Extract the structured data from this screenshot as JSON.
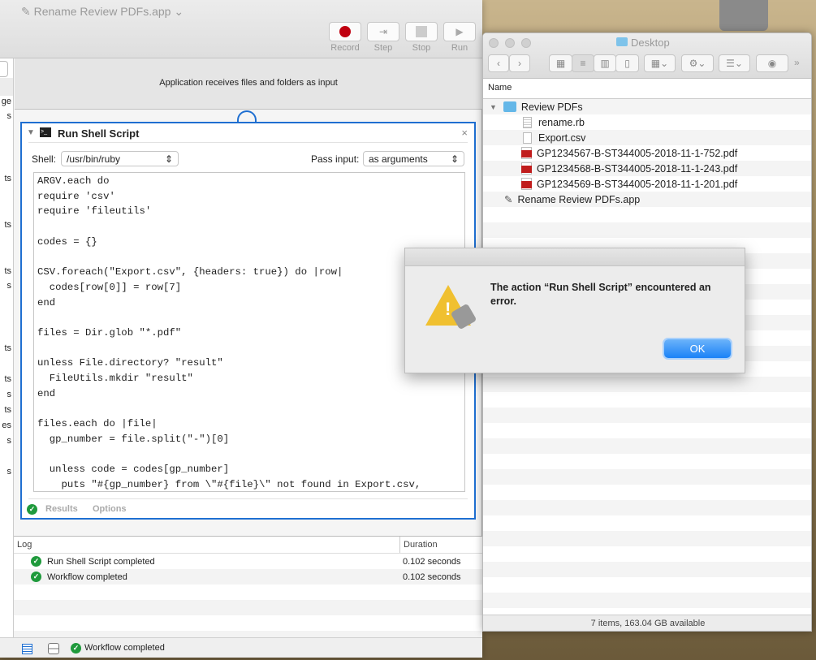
{
  "automator": {
    "title": "Rename Review PDFs.app",
    "toolbar": {
      "record": "Record",
      "step": "Step",
      "stop": "Stop",
      "run": "Run"
    },
    "sidebar_fragments": [
      "ge",
      "s",
      "ts",
      "ts",
      "ts",
      "s",
      "ts",
      "ts",
      "s",
      "ts",
      "es",
      "s",
      "s"
    ],
    "workflow_header": "Application receives files and folders as input",
    "action": {
      "title": "Run Shell Script",
      "shell_label": "Shell:",
      "shell_value": "/usr/bin/ruby",
      "pass_input_label": "Pass input:",
      "pass_input_value": "as arguments",
      "code": "ARGV.each do\nrequire 'csv'\nrequire 'fileutils'\n\ncodes = {}\n\nCSV.foreach(\"Export.csv\", {headers: true}) do |row|\n  codes[row[0]] = row[7]\nend\n\nfiles = Dir.glob \"*.pdf\"\n\nunless File.directory? \"result\"\n  FileUtils.mkdir \"result\"\nend\n\nfiles.each do |file|\n  gp_number = file.split(\"-\")[0]\n\n  unless code = codes[gp_number]\n    puts \"#{gp_number} from \\\"#{file}\\\" not found in Export.csv, skipping\"\n    next\n  end\n\n  puts \"#{gp_number} found, copying to result/#{code}.pdf\"\n  FileUtils.cp file, \"result/#{code}.pdf\"\nend",
      "results_tab": "Results",
      "options_tab": "Options"
    },
    "log": {
      "col_log": "Log",
      "col_duration": "Duration",
      "rows": [
        {
          "text": "Run Shell Script completed",
          "duration": "0.102 seconds"
        },
        {
          "text": "Workflow completed",
          "duration": "0.102 seconds"
        }
      ]
    },
    "status": "Workflow completed"
  },
  "finder": {
    "title": "Desktop",
    "column_name": "Name",
    "items": [
      {
        "name": "Review PDFs",
        "type": "folder"
      },
      {
        "name": "rename.rb",
        "type": "text"
      },
      {
        "name": "Export.csv",
        "type": "document"
      },
      {
        "name": "GP1234567-B-ST344005-2018-11-1-752.pdf",
        "type": "pdf"
      },
      {
        "name": "GP1234568-B-ST344005-2018-11-1-243.pdf",
        "type": "pdf"
      },
      {
        "name": "GP1234569-B-ST344005-2018-11-1-201.pdf",
        "type": "pdf"
      },
      {
        "name": "Rename Review PDFs.app",
        "type": "app"
      }
    ],
    "status": "7 items, 163.04 GB available"
  },
  "dialog": {
    "message": "The action “Run Shell Script” encountered an error.",
    "ok": "OK"
  },
  "colors": {
    "accent": "#1f6fd1",
    "record": "#c00010",
    "success": "#1f9a3c"
  }
}
